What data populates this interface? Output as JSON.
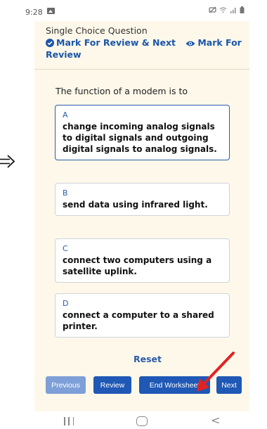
{
  "status_bar": {
    "time": "9:28",
    "left_icon": "gallery-icon",
    "right_icons": [
      "mute-icon",
      "wifi-icon",
      "signal-icon",
      "battery-icon"
    ]
  },
  "header": {
    "question_type": "Single Choice Question",
    "mark_review_next": "Mark For Review & Next",
    "mark_review": "Mark For Review",
    "mark_review_next_icon": "check-circle-icon",
    "mark_review_icon": "eye-icon"
  },
  "question": {
    "text": "The function of a modem is to"
  },
  "options": [
    {
      "letter": "A",
      "text": "change incoming analog signals to digital signals and outgoing digital signals to analog signals.",
      "selected": true
    },
    {
      "letter": "B",
      "text": "send data using infrared light.",
      "selected": false
    },
    {
      "letter": "C",
      "text": "connect two computers using a satellite uplink.",
      "selected": false
    },
    {
      "letter": "D",
      "text": "connect a computer to a shared printer.",
      "selected": false
    }
  ],
  "actions": {
    "reset": "Reset",
    "previous": "Previous",
    "review": "Review",
    "end_worksheet": "End Worksheet",
    "next": "Next"
  },
  "colors": {
    "accent": "#1f58b5",
    "disabled_button": "#7e9fd8",
    "content_background": "#fef8ea",
    "annotation_arrow": "#e32222"
  },
  "nav_bar": {
    "icons": [
      "recent-apps-icon",
      "home-icon",
      "back-icon"
    ]
  }
}
